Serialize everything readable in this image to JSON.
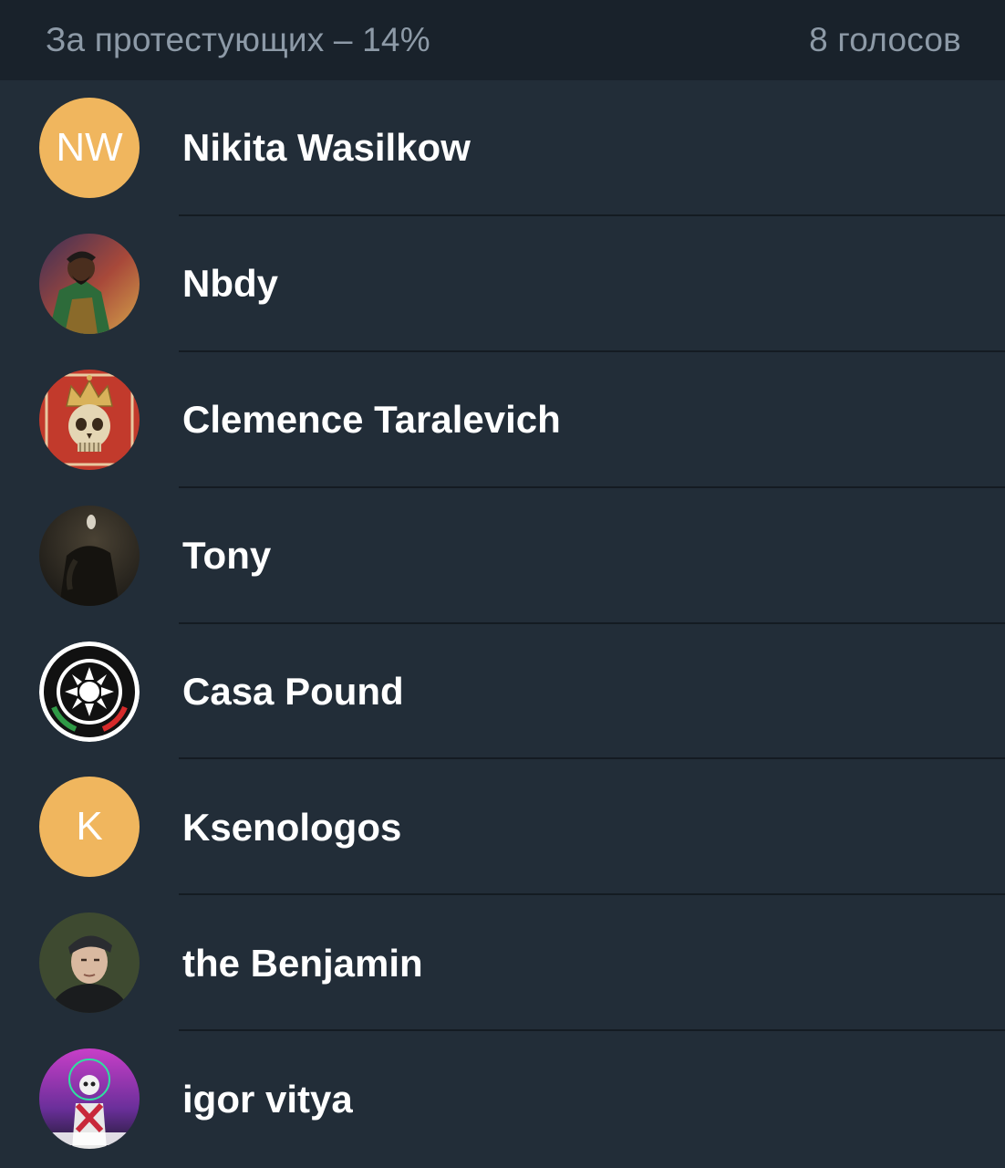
{
  "header": {
    "title": "За протестующих – 14%",
    "count": "8 голосов"
  },
  "voters": [
    {
      "name": "Nikita Wasilkow",
      "avatar": {
        "type": "initials",
        "initials": "NW",
        "color": "#f0b65e"
      }
    },
    {
      "name": "Nbdy",
      "avatar": {
        "type": "image",
        "icon": "cartoon-man-avatar-icon"
      }
    },
    {
      "name": "Clemence Taralevich",
      "avatar": {
        "type": "image",
        "icon": "crowned-skull-avatar-icon"
      }
    },
    {
      "name": "Tony",
      "avatar": {
        "type": "image",
        "icon": "dark-figure-avatar-icon"
      }
    },
    {
      "name": "Casa Pound",
      "avatar": {
        "type": "image",
        "icon": "turtle-emblem-avatar-icon"
      }
    },
    {
      "name": "Ksenologos",
      "avatar": {
        "type": "initials",
        "initials": "K",
        "color": "#f0b65e"
      }
    },
    {
      "name": "the Benjamin",
      "avatar": {
        "type": "image",
        "icon": "man-portrait-avatar-icon"
      }
    },
    {
      "name": "igor vitya",
      "avatar": {
        "type": "image",
        "icon": "neon-skeleton-avatar-icon"
      }
    }
  ],
  "colors": {
    "background": "#222d38",
    "header_background": "#19222b",
    "header_text": "#8d9aa7",
    "name_text": "#ffffff",
    "initials_avatar": "#f0b65e"
  }
}
